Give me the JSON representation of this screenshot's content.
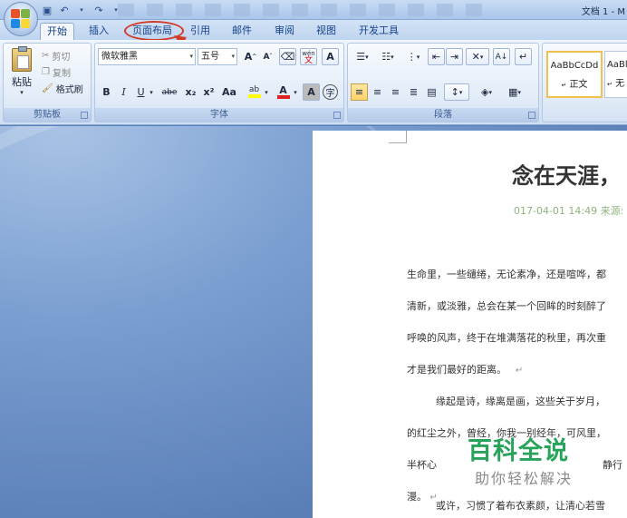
{
  "titlebar": {
    "title": "文档 1 - M"
  },
  "tabs": [
    {
      "label": "开始",
      "active": true
    },
    {
      "label": "插入"
    },
    {
      "label": "页面布局",
      "highlighted": true
    },
    {
      "label": "引用"
    },
    {
      "label": "邮件"
    },
    {
      "label": "审阅"
    },
    {
      "label": "视图"
    },
    {
      "label": "开发工具"
    }
  ],
  "clipboard": {
    "paste": "粘贴",
    "cut": "剪切",
    "copy": "复制",
    "format_painter": "格式刷",
    "label": "剪贴板"
  },
  "font": {
    "font_name": "微软雅黑",
    "font_size": "五号",
    "label": "字体",
    "grow": "A",
    "shrink": "A",
    "bold": "B",
    "italic": "I",
    "underline": "U",
    "strike": "abe",
    "subscript": "x₂",
    "superscript": "x²",
    "change_case": "Aa",
    "highlight": "ab",
    "font_color": "A",
    "char_shade": "A",
    "enclose": "字",
    "phonetic": "wén"
  },
  "paragraph": {
    "label": "段落"
  },
  "styles": {
    "items": [
      {
        "preview": "AaBbCcDd",
        "name": "正文"
      },
      {
        "preview": "AaBl",
        "name": "无"
      }
    ]
  },
  "document": {
    "title": "念在天涯，",
    "meta": "017-04-01 14:49 来源:",
    "lines": [
      "生命里，一些缱绻，无论素净，还是喧哗，都",
      "清新，或淡雅，总会在某一个回眸的时刻醉了",
      "呼唤的风声，终于在堆满落花的秋里，再次重",
      "才是我们最好的距离。",
      "缘起是诗，缘离是画，这些关于岁月，",
      "的红尘之外，曾经，你我一别经年，可风里，",
      "半杯心",
      "静行",
      "漫。",
      "或许，习惯了着布衣素颜，让清心若雪"
    ]
  },
  "watermark": {
    "title": "百科全说",
    "subtitle": "助你轻松解决"
  },
  "colors": {
    "annotation": "#d23a2a",
    "watermark": "#27a35a",
    "meta": "#8fb27f"
  }
}
